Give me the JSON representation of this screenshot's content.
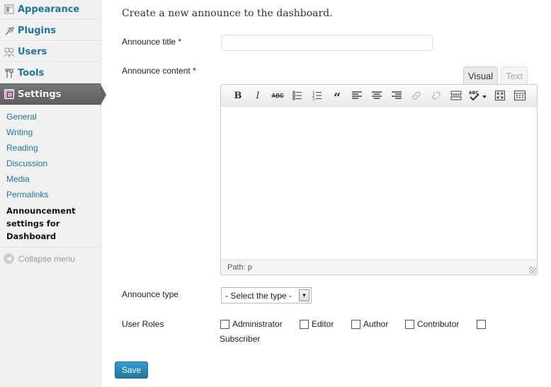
{
  "sidebar": {
    "menu": [
      {
        "label": "Appearance",
        "icon": "appearance-icon"
      },
      {
        "label": "Plugins",
        "icon": "plugin-icon"
      },
      {
        "label": "Users",
        "icon": "users-icon"
      },
      {
        "label": "Tools",
        "icon": "tools-icon"
      },
      {
        "label": "Settings",
        "icon": "settings-icon"
      }
    ],
    "submenu": [
      {
        "label": "General"
      },
      {
        "label": "Writing"
      },
      {
        "label": "Reading"
      },
      {
        "label": "Discussion"
      },
      {
        "label": "Media"
      },
      {
        "label": "Permalinks"
      },
      {
        "label": "Announcement\nsettings for\nDashboard"
      }
    ],
    "collapse_label": "Collapse menu"
  },
  "main": {
    "intro": "Create a new announce to the dashboard.",
    "title_label": "Announce title *",
    "title_value": "",
    "content_label": "Announce content *",
    "editor": {
      "tab_visual": "Visual",
      "tab_text": "Text",
      "path": "Path: p",
      "toolbar": [
        "bold-icon",
        "italic-icon",
        "strikethrough-icon",
        "bullet-list-icon",
        "numbered-list-icon",
        "blockquote-icon",
        "align-left-icon",
        "align-center-icon",
        "align-right-icon",
        "link-icon",
        "unlink-icon",
        "more-tag-icon",
        "spellcheck-icon",
        "fullscreen-icon",
        "kitchen-sink-icon"
      ]
    },
    "type_label": "Announce type",
    "type_select": "- Select the type -",
    "roles_label": "User Roles",
    "roles": [
      "Administrator",
      "Editor",
      "Author",
      "Contributor",
      "Subscriber"
    ],
    "save_label": "Save"
  },
  "colors": {
    "link": "#21759b",
    "sidebar_bg": "#f1f1f1",
    "active_menu": "#6d6d6d",
    "button": "#21759b"
  }
}
